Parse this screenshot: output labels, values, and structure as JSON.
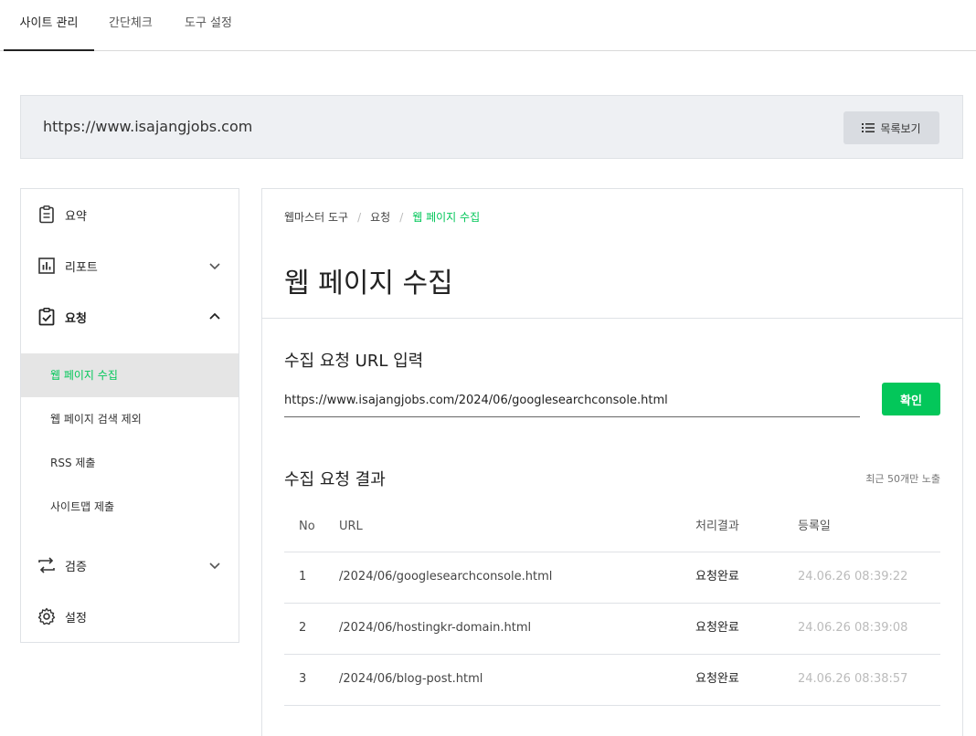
{
  "topnav": {
    "tabs": [
      {
        "label": "사이트 관리",
        "active": true
      },
      {
        "label": "간단체크",
        "active": false
      },
      {
        "label": "도구 설정",
        "active": false
      }
    ]
  },
  "site": {
    "url": "https://www.isajangjobs.com",
    "list_button": "목록보기"
  },
  "sidebar": {
    "items": [
      {
        "label": "요약",
        "icon": "clipboard-icon"
      },
      {
        "label": "리포트",
        "icon": "bar-chart-icon",
        "chevron": "down"
      },
      {
        "label": "요청",
        "icon": "clipboard-check-icon",
        "chevron": "up"
      },
      {
        "label": "검증",
        "icon": "repeat-icon",
        "chevron": "down"
      },
      {
        "label": "설정",
        "icon": "gear-icon"
      }
    ],
    "sub_items": [
      {
        "label": "웹 페이지 수집",
        "active": true
      },
      {
        "label": "웹 페이지 검색 제외",
        "active": false
      },
      {
        "label": "RSS 제출",
        "active": false
      },
      {
        "label": "사이트맵 제출",
        "active": false
      }
    ]
  },
  "main": {
    "breadcrumb": [
      "웹마스터 도구",
      "요청",
      "웹 페이지 수집"
    ],
    "title": "웹 페이지 수집",
    "input_section": {
      "title": "수집 요청 URL 입력",
      "value": "https://www.isajangjobs.com/2024/06/googlesearchconsole.html",
      "button": "확인"
    },
    "result_section": {
      "title": "수집 요청 결과",
      "note": "최근 50개만 노출",
      "headers": [
        "No",
        "URL",
        "처리결과",
        "등록일"
      ],
      "rows": [
        {
          "no": "1",
          "url": "/2024/06/googlesearchconsole.html",
          "result": "요청완료",
          "date": "24.06.26 08:39:22"
        },
        {
          "no": "2",
          "url": "/2024/06/hostingkr-domain.html",
          "result": "요청완료",
          "date": "24.06.26 08:39:08"
        },
        {
          "no": "3",
          "url": "/2024/06/blog-post.html",
          "result": "요청완료",
          "date": "24.06.26 08:38:57"
        }
      ]
    }
  },
  "colors": {
    "accent": "#03c75a",
    "panel": "#eef0f3",
    "border": "#dfe2e6"
  }
}
